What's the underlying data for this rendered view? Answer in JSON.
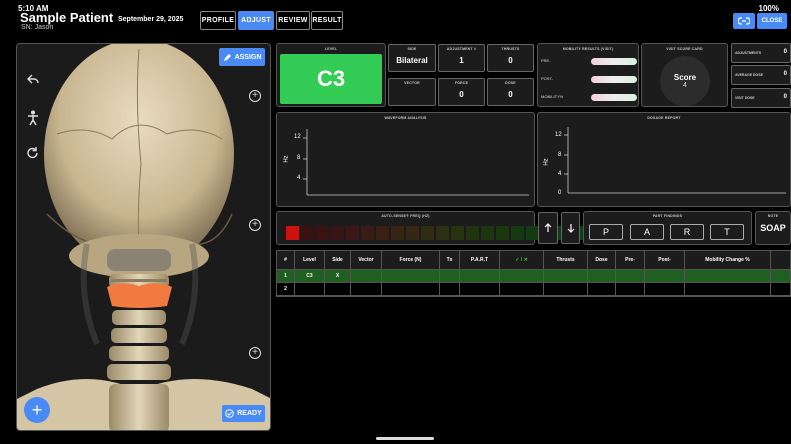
{
  "status": {
    "time": "5:10 AM",
    "battery": "100%"
  },
  "header": {
    "patient_name": "Sample Patient",
    "patient_sub": "SN: Jason",
    "date": "September 29, 2025",
    "tabs": [
      "PROFILE",
      "ADJUST",
      "REVIEW",
      "RESULT"
    ],
    "active_tab": "ADJUST",
    "close_label": "CLOSE"
  },
  "left": {
    "assign_label": "ASSIGN",
    "ready_label": "READY",
    "fab_label": "+"
  },
  "level": {
    "label": "LEVEL",
    "value": "C3",
    "color": "#33cc55"
  },
  "side": {
    "label": "SIDE",
    "value": "Bilateral"
  },
  "adjustment": {
    "label": "ADJUSTMENT #",
    "value": "1"
  },
  "thrusts": {
    "label": "THRUSTS",
    "value": "0"
  },
  "vector": {
    "label": "VECTOR",
    "value": ""
  },
  "force": {
    "label": "FORCE",
    "value": "0"
  },
  "dose": {
    "label": "DOSE",
    "value": "0"
  },
  "mobility": {
    "label": "MOBILITY RESULTS (VISIT)",
    "rows": [
      {
        "label": "PRE-"
      },
      {
        "label": "POST-"
      },
      {
        "label": "MOBILITY%"
      }
    ]
  },
  "visit_score": {
    "label": "VISIT SCORE CARD",
    "title": "Score",
    "value": "4"
  },
  "stats": [
    {
      "label": "ADJUSTMENTS",
      "value": "0"
    },
    {
      "label": "AVERAGE DOSE",
      "value": "0"
    },
    {
      "label": "VISIT DOSE",
      "value": "0"
    }
  ],
  "waveform": {
    "label": "WAVEFORM ANALYSIS",
    "ylabel": "Hz",
    "ticks": [
      "12",
      "8",
      "4"
    ]
  },
  "dosage": {
    "label": "DOSAGE REPORT",
    "ylabel": "Hz",
    "ticks": [
      "12",
      "8",
      "4",
      "0"
    ]
  },
  "autosense": {
    "label": "AUTO-SENSE® FREQ (HZ)",
    "segments": [
      "#cc1111",
      "#3a1111",
      "#3a1212",
      "#3a1414",
      "#3a1818",
      "#3a1c14",
      "#3a2012",
      "#382412",
      "#342812",
      "#302c12",
      "#2c3012",
      "#28320f",
      "#22340f",
      "#1e360f",
      "#1a380f",
      "#163a10",
      "#143a12",
      "#123a14",
      "#103c16",
      "#103c18"
    ]
  },
  "part_findings": {
    "label": "PART FINDINGS",
    "buttons": [
      "P",
      "A",
      "R",
      "T"
    ]
  },
  "note": {
    "label": "NOTE",
    "value": "SOAP"
  },
  "table": {
    "headers": [
      "#",
      "Level",
      "Side",
      "Vector",
      "Force (N)",
      "Tx",
      "P.A.R.T",
      "✓ / ✕",
      "Thrusts",
      "Dose",
      "Pre-",
      "Post-",
      "Mobility Change %"
    ],
    "rows": [
      [
        "1",
        "C3",
        "X",
        "",
        "",
        "",
        "",
        "",
        "",
        "",
        "",
        "",
        ""
      ],
      [
        "2",
        "",
        "",
        "",
        "",
        "",
        "",
        "",
        "",
        "",
        "",
        "",
        ""
      ]
    ]
  }
}
